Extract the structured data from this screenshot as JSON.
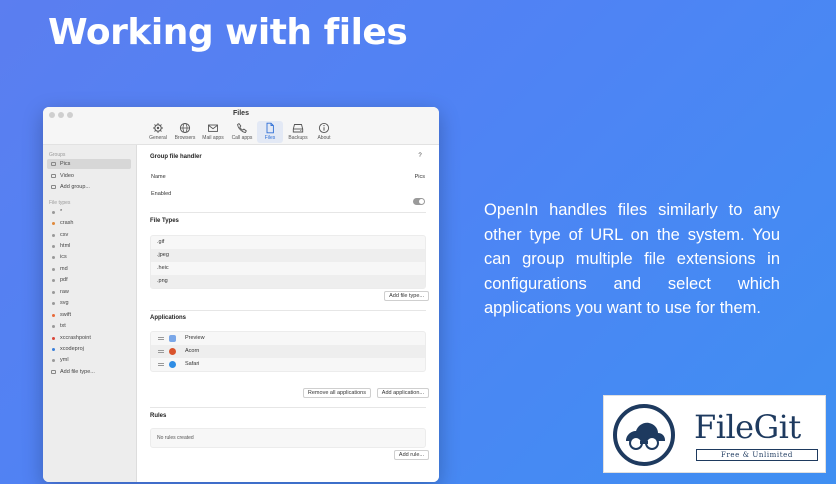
{
  "headline": "Working with files",
  "description": "OpenIn handles files similarly to any other type of URL on the system. You can group multiple file extensions in configurations and select which applications you want to use for them.",
  "window": {
    "title": "Files",
    "toolbar": [
      {
        "label": "General",
        "icon": "gear-icon"
      },
      {
        "label": "Browsers",
        "icon": "globe-icon"
      },
      {
        "label": "Mail apps",
        "icon": "envelope-icon"
      },
      {
        "label": "Call apps",
        "icon": "phone-icon"
      },
      {
        "label": "Files",
        "icon": "document-icon",
        "active": true
      },
      {
        "label": "Backups",
        "icon": "drive-icon"
      },
      {
        "label": "About",
        "icon": "info-icon"
      }
    ]
  },
  "sidebar": {
    "groups_heading": "Groups",
    "groups": [
      {
        "label": "Pics",
        "selected": true
      },
      {
        "label": "Video"
      }
    ],
    "add_group": "Add group...",
    "filetypes_heading": "File types",
    "file_types": [
      "*",
      "crash",
      "csv",
      "html",
      "ics",
      "md",
      "pdf",
      "raw",
      "svg",
      "swift",
      "txt",
      "xccrashpoint",
      "xcodeproj",
      "yml"
    ],
    "add_file_type": "Add file type..."
  },
  "main": {
    "group_handler": {
      "title": "Group file handler",
      "help": "?",
      "name_label": "Name",
      "name_value": "Pics",
      "enabled_label": "Enabled",
      "enabled": true
    },
    "file_types": {
      "title": "File Types",
      "items": [
        ".gif",
        ".jpeg",
        ".heic",
        ".png"
      ],
      "add_button": "Add file type..."
    },
    "applications": {
      "title": "Applications",
      "items": [
        {
          "name": "Preview",
          "color": "#7aa7e8"
        },
        {
          "name": "Acorn",
          "color": "#d9532c"
        },
        {
          "name": "Safari",
          "color": "#2f8de4"
        }
      ],
      "remove_all_button": "Remove all applications",
      "add_button": "Add application..."
    },
    "rules": {
      "title": "Rules",
      "empty_text": "No rules created",
      "add_button": "Add rule..."
    }
  },
  "badge": {
    "name": "FileGit",
    "tagline": "Free & Unlimited",
    "brand_color": "#1e3a5f"
  },
  "colors": {
    "background_start": "#5b7ef0",
    "background_end": "#3f8ff2",
    "accent": "#2f6fd6"
  }
}
